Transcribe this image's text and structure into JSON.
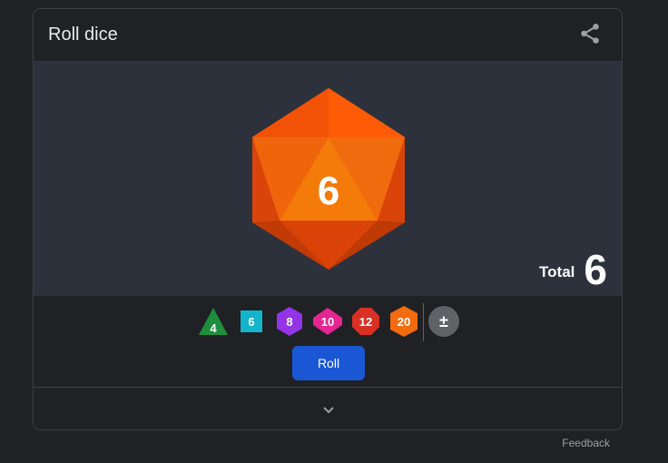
{
  "card": {
    "title": "Roll dice",
    "share_icon": "share-icon"
  },
  "result": {
    "die_type": "d20",
    "face_value": "6",
    "total_label": "Total",
    "total_value": "6",
    "die_color": "#f36b0f"
  },
  "dice_selector": [
    {
      "name": "d4",
      "label": "4",
      "color": "#1e8e3e"
    },
    {
      "name": "d6",
      "label": "6",
      "color": "#12b5cb"
    },
    {
      "name": "d8",
      "label": "8",
      "color": "#9334e6"
    },
    {
      "name": "d10",
      "label": "10",
      "color": "#e52592"
    },
    {
      "name": "d12",
      "label": "12",
      "color": "#d93025"
    },
    {
      "name": "d20",
      "label": "20",
      "color": "#f26b0f"
    },
    {
      "name": "modifier",
      "label": "±",
      "color": "#5f6368"
    }
  ],
  "actions": {
    "roll_label": "Roll",
    "roll_color": "#1a57d4",
    "expand_icon": "chevron-down-icon"
  },
  "footer": {
    "feedback_label": "Feedback"
  }
}
